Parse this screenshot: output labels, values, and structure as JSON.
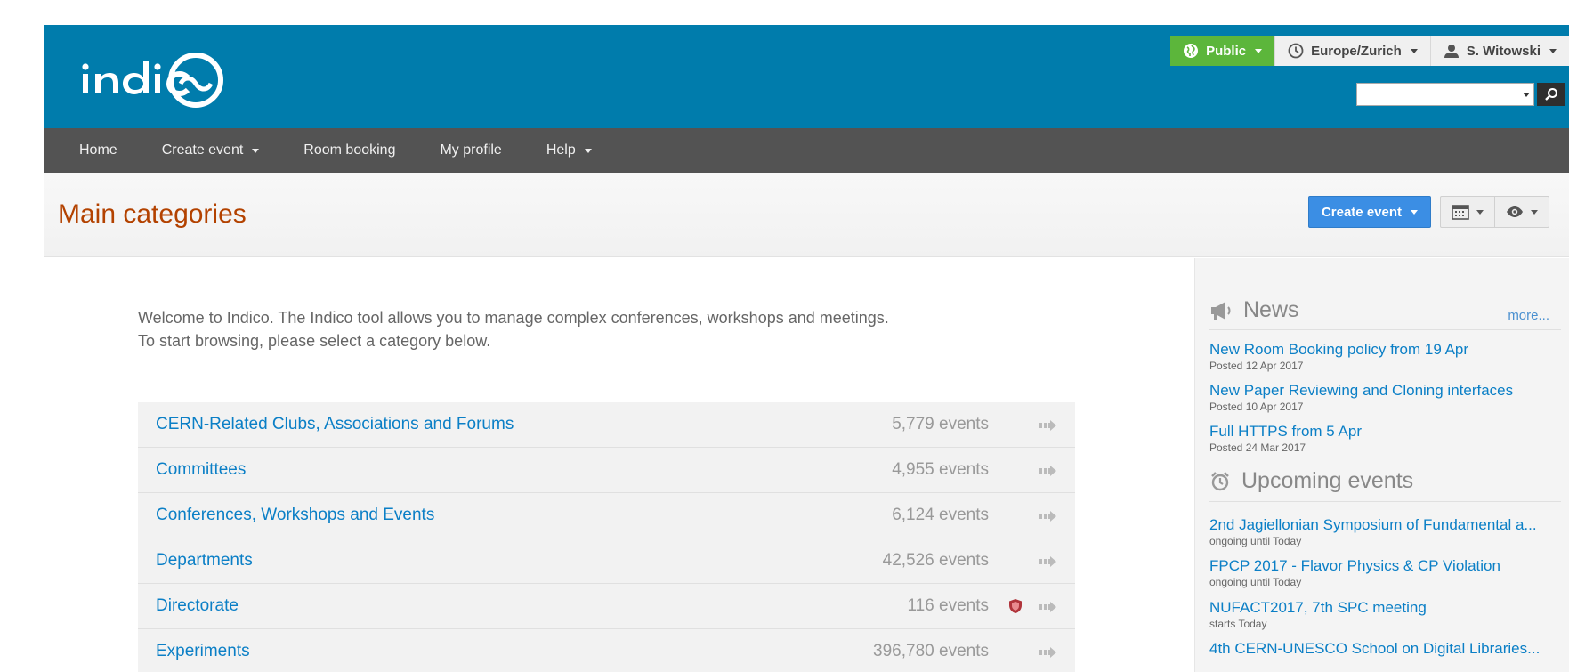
{
  "header": {
    "user_bar": {
      "visibility": "Public",
      "timezone": "Europe/Zurich",
      "user": "S. Witowski"
    },
    "search": {
      "placeholder": ""
    }
  },
  "nav": {
    "items": [
      {
        "label": "Home",
        "dropdown": false
      },
      {
        "label": "Create event",
        "dropdown": true
      },
      {
        "label": "Room booking",
        "dropdown": false
      },
      {
        "label": "My profile",
        "dropdown": false
      },
      {
        "label": "Help",
        "dropdown": true
      }
    ]
  },
  "title_bar": {
    "title": "Main categories",
    "create_event_label": "Create event"
  },
  "welcome": {
    "line1": "Welcome to Indico. The Indico tool allows you to manage complex conferences, workshops and meetings.",
    "line2": "To start browsing, please select a category below."
  },
  "categories": [
    {
      "name": "CERN-Related Clubs, Associations and Forums",
      "count": "5,779 events",
      "protected": false
    },
    {
      "name": "Committees",
      "count": "4,955 events",
      "protected": false
    },
    {
      "name": "Conferences, Workshops and Events",
      "count": "6,124 events",
      "protected": false
    },
    {
      "name": "Departments",
      "count": "42,526 events",
      "protected": false
    },
    {
      "name": "Directorate",
      "count": "116 events",
      "protected": true
    },
    {
      "name": "Experiments",
      "count": "396,780 events",
      "protected": false
    }
  ],
  "sidebar": {
    "news": {
      "title": "News",
      "more": "more...",
      "items": [
        {
          "title": "New Room Booking policy from 19 Apr",
          "meta": "Posted 12 Apr 2017"
        },
        {
          "title": "New Paper Reviewing and Cloning interfaces",
          "meta": "Posted 10 Apr 2017"
        },
        {
          "title": "Full HTTPS from 5 Apr",
          "meta": "Posted 24 Mar 2017"
        }
      ]
    },
    "upcoming": {
      "title": "Upcoming events",
      "items": [
        {
          "title": "2nd Jagiellonian Symposium of Fundamental a...",
          "meta": "ongoing until Today"
        },
        {
          "title": "FPCP 2017 - Flavor Physics & CP Violation",
          "meta": "ongoing until Today"
        },
        {
          "title": "NUFACT2017, 7th SPC meeting",
          "meta": "starts Today"
        },
        {
          "title": "4th CERN-UNESCO School on Digital Libraries...",
          "meta": ""
        }
      ]
    }
  },
  "colors": {
    "header_bg": "#007cac",
    "nav_bg": "#535353",
    "public_green": "#5cb63b",
    "title_orange": "#b34200",
    "link_blue": "#0b7fc6",
    "button_blue": "#3b8ee4"
  },
  "icons": {
    "logo": "indico-logo",
    "public": "globe-icon",
    "timezone": "clock-icon",
    "user": "user-icon",
    "search": "search-icon",
    "calendar": "calendar-icon",
    "view": "eye-icon",
    "news": "megaphone-icon",
    "upcoming": "alarm-clock-icon",
    "protected": "shield-icon",
    "go": "arrow-right-icon"
  }
}
